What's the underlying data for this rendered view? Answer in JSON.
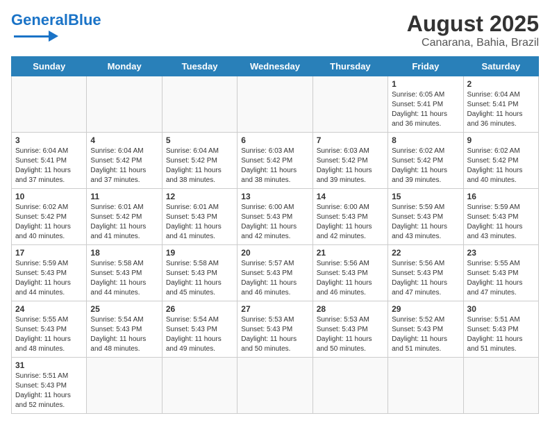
{
  "header": {
    "logo_general": "General",
    "logo_blue": "Blue",
    "main_title": "August 2025",
    "subtitle": "Canarana, Bahia, Brazil"
  },
  "days_of_week": [
    "Sunday",
    "Monday",
    "Tuesday",
    "Wednesday",
    "Thursday",
    "Friday",
    "Saturday"
  ],
  "weeks": [
    [
      {
        "date": "",
        "info": ""
      },
      {
        "date": "",
        "info": ""
      },
      {
        "date": "",
        "info": ""
      },
      {
        "date": "",
        "info": ""
      },
      {
        "date": "",
        "info": ""
      },
      {
        "date": "1",
        "info": "Sunrise: 6:05 AM\nSunset: 5:41 PM\nDaylight: 11 hours and 36 minutes."
      },
      {
        "date": "2",
        "info": "Sunrise: 6:04 AM\nSunset: 5:41 PM\nDaylight: 11 hours and 36 minutes."
      }
    ],
    [
      {
        "date": "3",
        "info": "Sunrise: 6:04 AM\nSunset: 5:41 PM\nDaylight: 11 hours and 37 minutes."
      },
      {
        "date": "4",
        "info": "Sunrise: 6:04 AM\nSunset: 5:42 PM\nDaylight: 11 hours and 37 minutes."
      },
      {
        "date": "5",
        "info": "Sunrise: 6:04 AM\nSunset: 5:42 PM\nDaylight: 11 hours and 38 minutes."
      },
      {
        "date": "6",
        "info": "Sunrise: 6:03 AM\nSunset: 5:42 PM\nDaylight: 11 hours and 38 minutes."
      },
      {
        "date": "7",
        "info": "Sunrise: 6:03 AM\nSunset: 5:42 PM\nDaylight: 11 hours and 39 minutes."
      },
      {
        "date": "8",
        "info": "Sunrise: 6:02 AM\nSunset: 5:42 PM\nDaylight: 11 hours and 39 minutes."
      },
      {
        "date": "9",
        "info": "Sunrise: 6:02 AM\nSunset: 5:42 PM\nDaylight: 11 hours and 40 minutes."
      }
    ],
    [
      {
        "date": "10",
        "info": "Sunrise: 6:02 AM\nSunset: 5:42 PM\nDaylight: 11 hours and 40 minutes."
      },
      {
        "date": "11",
        "info": "Sunrise: 6:01 AM\nSunset: 5:42 PM\nDaylight: 11 hours and 41 minutes."
      },
      {
        "date": "12",
        "info": "Sunrise: 6:01 AM\nSunset: 5:43 PM\nDaylight: 11 hours and 41 minutes."
      },
      {
        "date": "13",
        "info": "Sunrise: 6:00 AM\nSunset: 5:43 PM\nDaylight: 11 hours and 42 minutes."
      },
      {
        "date": "14",
        "info": "Sunrise: 6:00 AM\nSunset: 5:43 PM\nDaylight: 11 hours and 42 minutes."
      },
      {
        "date": "15",
        "info": "Sunrise: 5:59 AM\nSunset: 5:43 PM\nDaylight: 11 hours and 43 minutes."
      },
      {
        "date": "16",
        "info": "Sunrise: 5:59 AM\nSunset: 5:43 PM\nDaylight: 11 hours and 43 minutes."
      }
    ],
    [
      {
        "date": "17",
        "info": "Sunrise: 5:59 AM\nSunset: 5:43 PM\nDaylight: 11 hours and 44 minutes."
      },
      {
        "date": "18",
        "info": "Sunrise: 5:58 AM\nSunset: 5:43 PM\nDaylight: 11 hours and 44 minutes."
      },
      {
        "date": "19",
        "info": "Sunrise: 5:58 AM\nSunset: 5:43 PM\nDaylight: 11 hours and 45 minutes."
      },
      {
        "date": "20",
        "info": "Sunrise: 5:57 AM\nSunset: 5:43 PM\nDaylight: 11 hours and 46 minutes."
      },
      {
        "date": "21",
        "info": "Sunrise: 5:56 AM\nSunset: 5:43 PM\nDaylight: 11 hours and 46 minutes."
      },
      {
        "date": "22",
        "info": "Sunrise: 5:56 AM\nSunset: 5:43 PM\nDaylight: 11 hours and 47 minutes."
      },
      {
        "date": "23",
        "info": "Sunrise: 5:55 AM\nSunset: 5:43 PM\nDaylight: 11 hours and 47 minutes."
      }
    ],
    [
      {
        "date": "24",
        "info": "Sunrise: 5:55 AM\nSunset: 5:43 PM\nDaylight: 11 hours and 48 minutes."
      },
      {
        "date": "25",
        "info": "Sunrise: 5:54 AM\nSunset: 5:43 PM\nDaylight: 11 hours and 48 minutes."
      },
      {
        "date": "26",
        "info": "Sunrise: 5:54 AM\nSunset: 5:43 PM\nDaylight: 11 hours and 49 minutes."
      },
      {
        "date": "27",
        "info": "Sunrise: 5:53 AM\nSunset: 5:43 PM\nDaylight: 11 hours and 50 minutes."
      },
      {
        "date": "28",
        "info": "Sunrise: 5:53 AM\nSunset: 5:43 PM\nDaylight: 11 hours and 50 minutes."
      },
      {
        "date": "29",
        "info": "Sunrise: 5:52 AM\nSunset: 5:43 PM\nDaylight: 11 hours and 51 minutes."
      },
      {
        "date": "30",
        "info": "Sunrise: 5:51 AM\nSunset: 5:43 PM\nDaylight: 11 hours and 51 minutes."
      }
    ],
    [
      {
        "date": "31",
        "info": "Sunrise: 5:51 AM\nSunset: 5:43 PM\nDaylight: 11 hours and 52 minutes."
      },
      {
        "date": "",
        "info": ""
      },
      {
        "date": "",
        "info": ""
      },
      {
        "date": "",
        "info": ""
      },
      {
        "date": "",
        "info": ""
      },
      {
        "date": "",
        "info": ""
      },
      {
        "date": "",
        "info": ""
      }
    ]
  ]
}
